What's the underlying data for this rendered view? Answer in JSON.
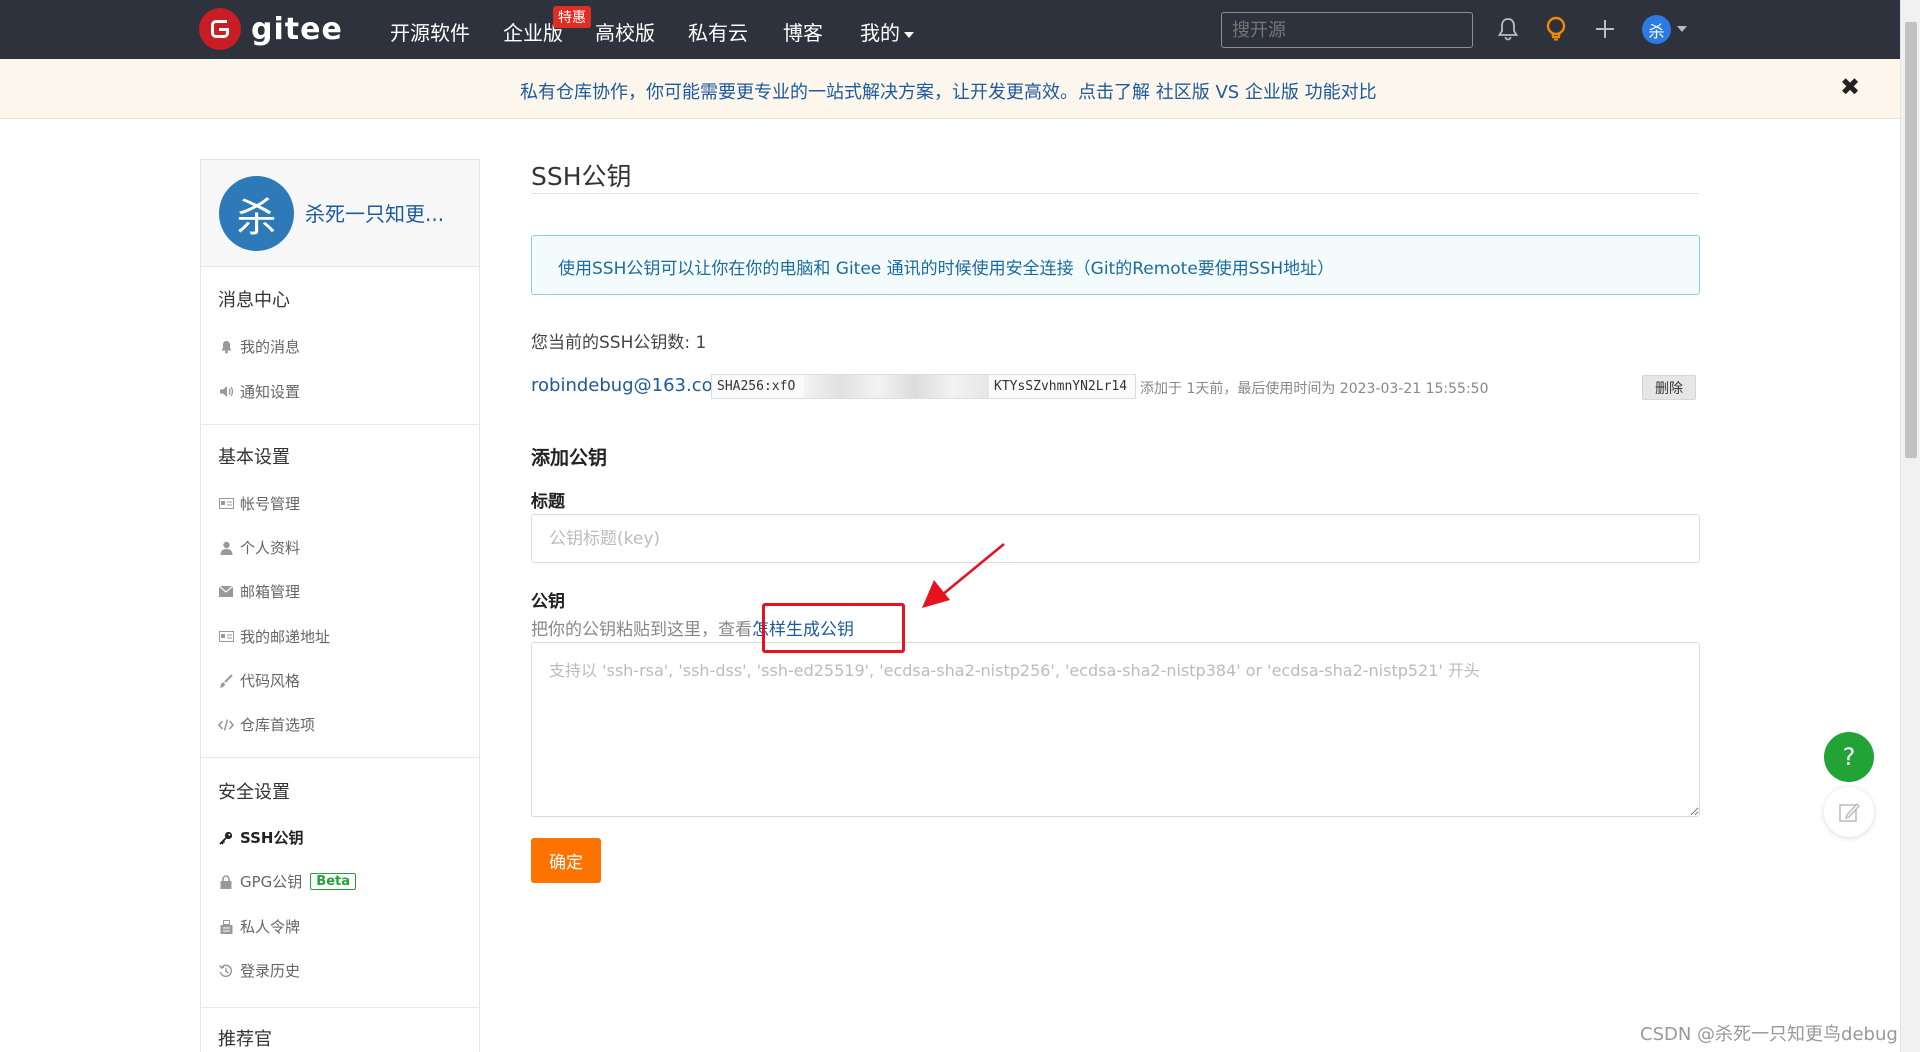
{
  "nav": {
    "logo_text": "gitee",
    "items": [
      "开源软件",
      "企业版",
      "高校版",
      "私有云",
      "博客",
      "我的"
    ],
    "enterprise_badge": "特惠",
    "search_placeholder": "搜开源",
    "avatar_char": "杀"
  },
  "banner": {
    "text": "私有仓库协作，你可能需要更专业的一站式解决方案，让开发更高效。点击了解 社区版 VS 企业版 功能对比",
    "close": "✖"
  },
  "sidebar": {
    "avatar_char": "杀",
    "username": "杀死一只知更...",
    "groups": [
      {
        "title": "消息中心",
        "items": [
          {
            "label": "我的消息",
            "icon": "bell-icon"
          },
          {
            "label": "通知设置",
            "icon": "volume-icon"
          }
        ]
      },
      {
        "title": "基本设置",
        "items": [
          {
            "label": "帐号管理",
            "icon": "id-card-icon"
          },
          {
            "label": "个人资料",
            "icon": "user-icon"
          },
          {
            "label": "邮箱管理",
            "icon": "envelope-icon"
          },
          {
            "label": "我的邮递地址",
            "icon": "address-card-icon"
          },
          {
            "label": "代码风格",
            "icon": "brush-icon"
          },
          {
            "label": "仓库首选项",
            "icon": "code-icon"
          }
        ]
      },
      {
        "title": "安全设置",
        "items": [
          {
            "label": "SSH公钥",
            "icon": "key-icon"
          },
          {
            "label": "GPG公钥",
            "icon": "lock-icon",
            "badge": "Beta"
          },
          {
            "label": "私人令牌",
            "icon": "token-icon"
          },
          {
            "label": "登录历史",
            "icon": "history-icon"
          }
        ]
      },
      {
        "title": "推荐官",
        "items": []
      }
    ]
  },
  "main": {
    "title": "SSH公钥",
    "info": "使用SSH公钥可以让你在你的电脑和 Gitee 通讯的时候使用安全连接（Git的Remote要使用SSH地址）",
    "key_count": "您当前的SSH公钥数: 1",
    "key": {
      "email": "robindebug@163.com",
      "fingerprint_head": "SHA256:xfO",
      "fingerprint_tail": "KTYsSZvhmnYN2Lr14",
      "meta": "添加于 1天前，最后使用时间为 2023-03-21 15:55:50",
      "delete_label": "删除"
    },
    "add_heading": "添加公钥",
    "title_label": "标题",
    "title_placeholder": "公钥标题(key)",
    "key_label": "公钥",
    "hint_prefix": "把你的公钥粘贴到这里，查看",
    "hint_link": "怎样生成公钥",
    "key_placeholder": "支持以 'ssh-rsa', 'ssh-dss', 'ssh-ed25519', 'ecdsa-sha2-nistp256', 'ecdsa-sha2-nistp384' or 'ecdsa-sha2-nistp521' 开头",
    "confirm_label": "确定"
  },
  "float": {
    "help": "?"
  },
  "watermark": "CSDN @杀死一只知更鸟debug",
  "colors": {
    "nav_bg": "#2e323c",
    "brand_red": "#c71d23",
    "accent_orange": "#fe7300",
    "link_blue": "#1c5a9e",
    "success_green": "#21a336",
    "annotation_red": "#e8121e"
  }
}
